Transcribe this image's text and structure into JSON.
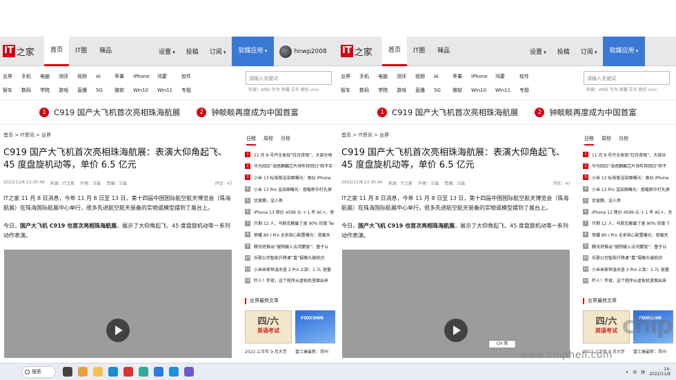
{
  "site": {
    "logo_it": "IT",
    "logo_name": "之家"
  },
  "nav": {
    "items": [
      "首页",
      "IT圈",
      "辣品"
    ],
    "right": [
      "设置",
      "投稿",
      "订阅"
    ],
    "app_button": "软媒应用",
    "username": "hnwp2008"
  },
  "categories": {
    "row1": [
      "业界",
      "手机",
      "电脑",
      "测评",
      "视频",
      "AI",
      "苹果",
      "iPhone",
      "鸿蒙",
      "软件"
    ],
    "row2": [
      "智车",
      "数码",
      "学院",
      "游戏",
      "直播",
      "5G",
      "微软",
      "Win10",
      "Win11",
      "专题"
    ]
  },
  "search": {
    "placeholder": "请输入关键词",
    "hot": "热搜：AMD  华为  荣耀  立华  微信  vivo"
  },
  "headlines": [
    {
      "num": "1",
      "text": "C919 国产大飞机首次亮相珠海航展"
    },
    {
      "num": "2",
      "text": "钟睒睒再度成为中国首富"
    }
  ],
  "breadcrumb_left": "首页  >  IT资讯  >  业界",
  "breadcrumb_right": "首页  >  IT资讯  >  业界",
  "article": {
    "title": "C919 国产大飞机首次亮相珠海航展：表演大仰角起飞、45 度盘旋机动等，单价 6.5 亿元",
    "date": "2022/11/8 13:30:46",
    "source": "来源：IT之家",
    "author": "作者：汪淼",
    "editor": "责编：汪淼",
    "comments": "评论：47",
    "p1": "IT之家 11 月 8 日消息，今年 11 月 8 日至 13 日，第十四届中国国际航空航天博览会（珠海航展）在珠海国际航展中心举行，很多先进航空航天装备的实物或模型摆到了展台上。",
    "p2_prefix": "今日，",
    "p2_bold": "国产大飞机 C919 也首次亮相珠海航展",
    "p2_suffix": "，展示了大仰角起飞、45 度盘旋机动等一系列动作表演。"
  },
  "sidebar": {
    "tabs": [
      "日榜",
      "周榜",
      "月榜"
    ],
    "list": [
      "11 月 8 号开全食现“红月奇观”，大部分地",
      "华为回应“海思麒麟芯片领年将回归”称不实",
      "小米 13 标准版渲染图曝光：类似 iPhone",
      "小米 13 Pro 渲染图曝光：搭载新中打孔屏",
      "优爱腾，没人疼",
      "iPhone 13 降价 4599 元 + 1 年 AC+，新",
      "只剩 12 人，马斯克解雇了逾 90% 印度 Tw",
      "荣耀 80 / Pro 全系核心配置曝光：搭载天",
      "腾讯将推出“搜狗输入法鸿蒙版”：基于以",
      "乐歌公司智能升降桌“嘉”摄像头被拍识",
      "小米米家恒温水壶 2 Pro 上架：1.7L 容量",
      "吓人！年夜，这个程序从虚拟机里面出来"
    ],
    "list_right": [
      "11 月 8 号开全食现“红月奇观”，大部分",
      "华为回应“海思麒麟芯片领年将回归”称不",
      "小米 13 标准版渲染图曝光：类似 iPhone",
      "小米 13 Pro 渲染图曝光：搭载新中打孔屏",
      "优爱腾，没人疼",
      "iPhone 13 降价 4599 元 + 1 年 AC+，负",
      "只剩 12 人，马斯克解雇了逾 90% 印度 T",
      "荣耀 80 / Pro 全系核心配置曝光：搭载天",
      "腾讯将推出“搜狗输入法鸿蒙版”：基于以",
      "乐歌公司智能升降桌“嘉”摄像头被拍识",
      "小米米家恒温水壶 2 Pro 上架：1.7L 容量",
      "吓人！年夜，这个程序从虚拟机里面出来"
    ],
    "hot_title": "业界最热文章",
    "thumb1_a": "四/六",
    "thumb1_b": "英语考试",
    "thumb2_text": "FOXCONN",
    "captions": [
      "2022 上半年 9 月大学",
      "富士康最新：郑州"
    ]
  },
  "overlay": {
    "ime": "CH 简",
    "watermark": "www.chiphell.com",
    "watermark_cn": "chip"
  },
  "taskbar": {
    "search": "搜索",
    "tray": [
      "∧",
      "中",
      "拼"
    ],
    "time": "14:",
    "date": "2022/11/8"
  }
}
